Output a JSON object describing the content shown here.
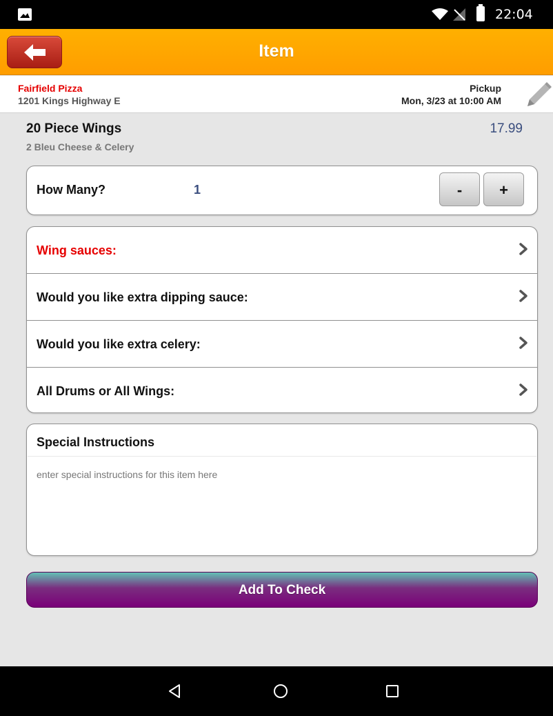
{
  "status_bar": {
    "time": "22:04"
  },
  "header": {
    "title": "Item"
  },
  "store": {
    "name": "Fairfield Pizza",
    "address": "1201 Kings Highway E",
    "order_type": "Pickup",
    "order_time": "Mon, 3/23 at 10:00 AM"
  },
  "item": {
    "name": "20 Piece Wings",
    "description": "2 Bleu Cheese & Celery",
    "price": "17.99"
  },
  "quantity": {
    "label": "How Many?",
    "value": "1",
    "minus_label": "-",
    "plus_label": "+"
  },
  "options": [
    {
      "label": "Wing sauces:",
      "required": true
    },
    {
      "label": "Would you like extra dipping sauce:",
      "required": false
    },
    {
      "label": "Would you like extra celery:",
      "required": false
    },
    {
      "label": "All Drums or All Wings:",
      "required": false
    }
  ],
  "special_instructions": {
    "title": "Special Instructions",
    "placeholder": "enter special instructions for this item here",
    "value": ""
  },
  "add_button_label": "Add To Check",
  "colors": {
    "header_orange": "#ff9d00",
    "required_red": "#e60000",
    "price_blue": "#3a4d7e",
    "button_purple": "#7a0079"
  }
}
